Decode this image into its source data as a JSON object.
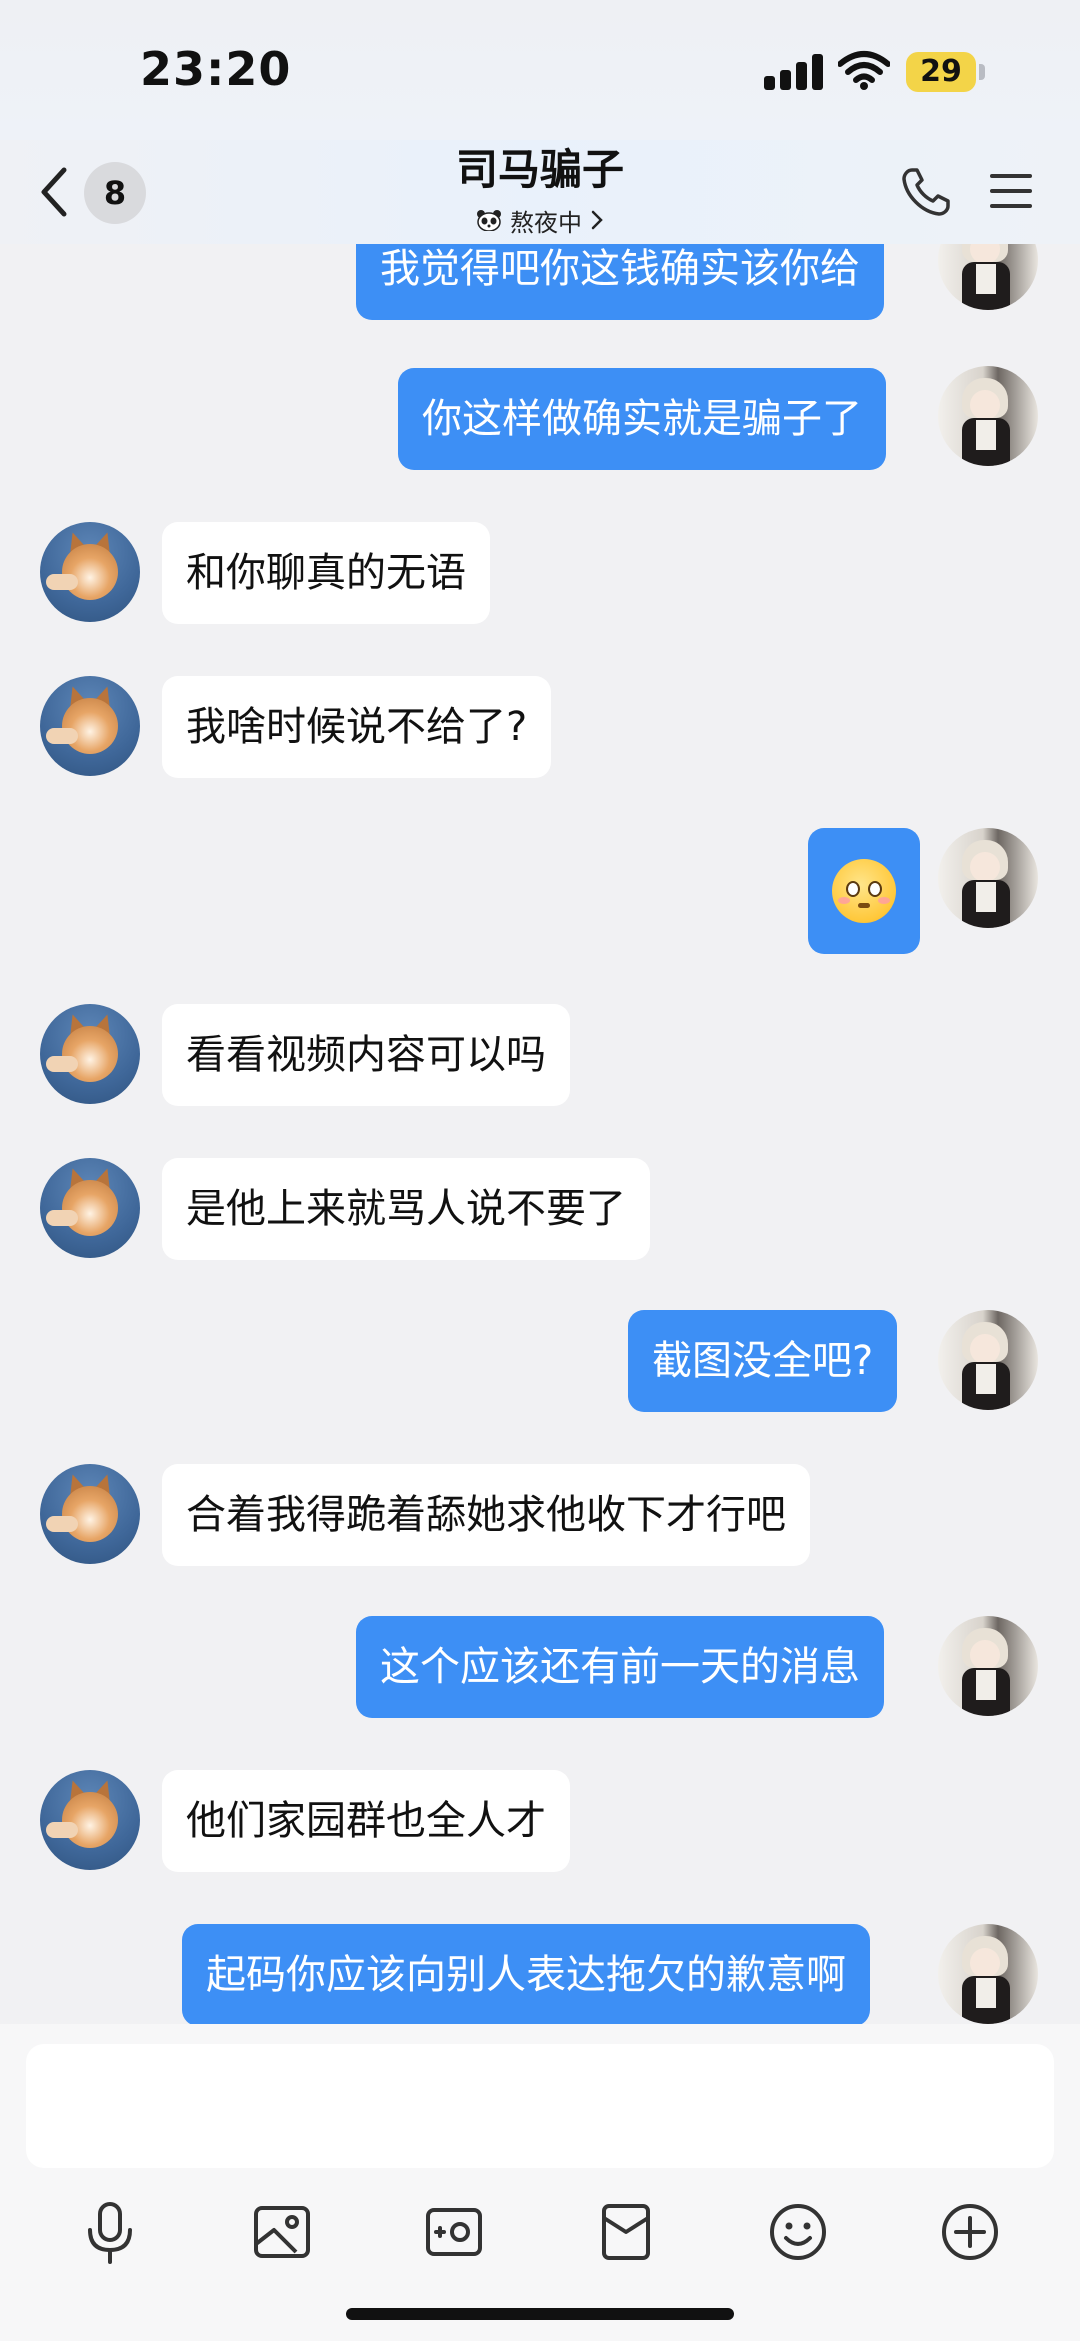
{
  "status_bar": {
    "time": "23:20",
    "battery": "29"
  },
  "header": {
    "unread_count": "8",
    "title": "司马骗子",
    "status": "熬夜中"
  },
  "messages": [
    {
      "side": "out",
      "text": "我觉得吧你这钱确实该你给"
    },
    {
      "side": "out",
      "text": "你这样做确实就是骗子了"
    },
    {
      "side": "in",
      "text": "和你聊真的无语"
    },
    {
      "side": "in",
      "text": "我啥时候说不给了?"
    },
    {
      "side": "out",
      "emoji": "pleading-face-emoji"
    },
    {
      "side": "in",
      "text": "看看视频内容可以吗"
    },
    {
      "side": "in",
      "text": "是他上来就骂人说不要了"
    },
    {
      "side": "out",
      "text": "截图没全吧?"
    },
    {
      "side": "in",
      "text": "合着我得跪着舔她求他收下才行吧"
    },
    {
      "side": "out",
      "text": "这个应该还有前一天的消息"
    },
    {
      "side": "in",
      "text": "他们家园群也全人才"
    },
    {
      "side": "out",
      "text": "起码你应该向别人表达拖欠的歉意啊"
    }
  ],
  "composer": {
    "input_value": "",
    "tools": [
      "microphone-icon",
      "image-icon",
      "camera-icon",
      "red-packet-icon",
      "emoji-icon",
      "plus-icon"
    ]
  },
  "colors": {
    "outgoing_bubble": "#3d8ff5",
    "incoming_bubble": "#ffffff",
    "background": "#f1f1f3"
  }
}
